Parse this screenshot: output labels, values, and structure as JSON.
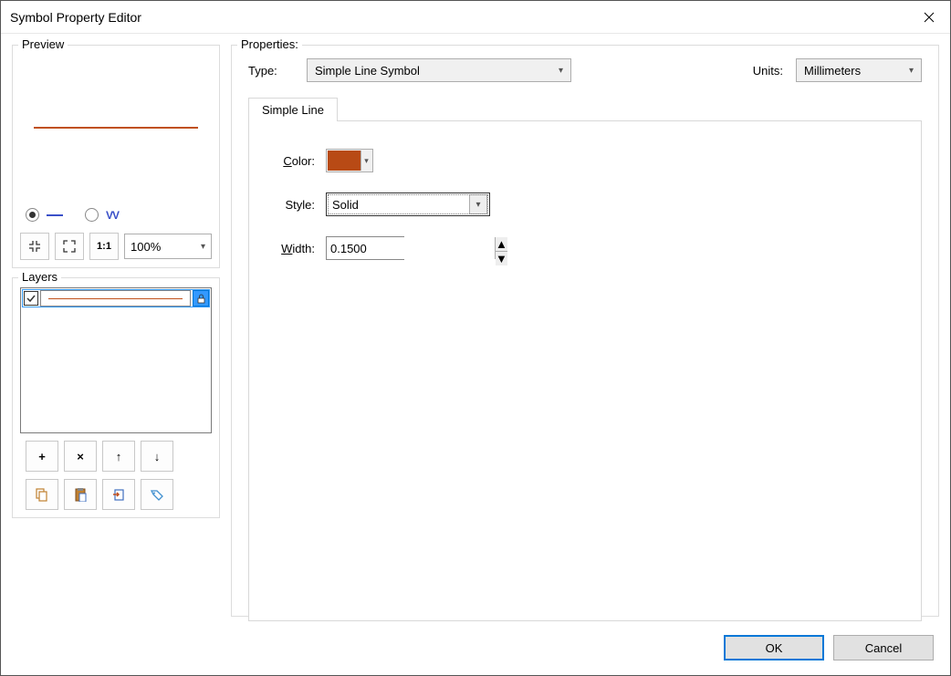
{
  "window": {
    "title": "Symbol Property Editor"
  },
  "preview": {
    "label": "Preview",
    "zoom": "100%",
    "line_color": "#c0501a"
  },
  "layers": {
    "label": "Layers"
  },
  "properties": {
    "label": "Properties:",
    "type_label": "Type:",
    "type_value": "Simple Line Symbol",
    "units_label": "Units:",
    "units_value": "Millimeters"
  },
  "tabs": {
    "simple_line": "Simple Line"
  },
  "fields": {
    "color_label": "Color:",
    "color_value": "#b84a15",
    "style_label": "Style:",
    "style_value": "Solid",
    "width_label": "Width:",
    "width_value": "0.1500"
  },
  "buttons": {
    "ok": "OK",
    "cancel": "Cancel"
  }
}
